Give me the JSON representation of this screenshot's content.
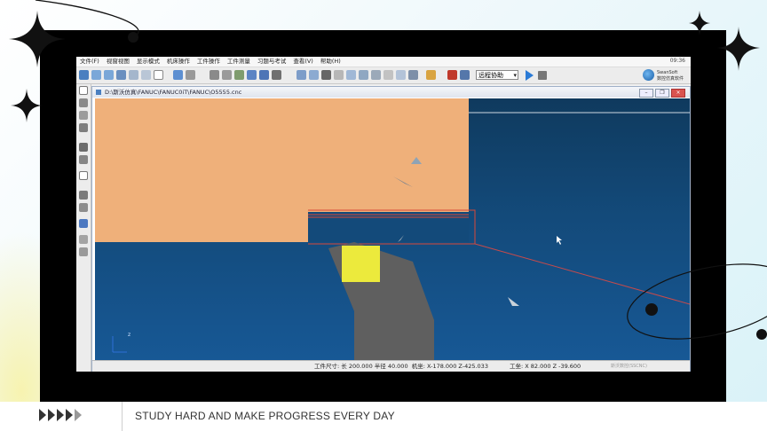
{
  "menu": [
    "文件(F)",
    "视窗视图",
    "显示模式",
    "机床操作",
    "工件操作",
    "工件测量",
    "习题与考试",
    "查看(V)",
    "帮助(H)"
  ],
  "clock": "09:36",
  "toolbar": {
    "mode_select": "远程协助"
  },
  "brand": {
    "name": "SwanSoft",
    "subtitle": "数控仿真软件"
  },
  "document": {
    "path": "D:\\斯沃仿真\\FANUC\\FANUC0iT\\FANUC\\O5555.cnc"
  },
  "status": {
    "workpiece_size": "工件尺寸: 长 200.000 半径 40.000",
    "machine_coords": "机坐: X-178.000  Z-425.033",
    "workpiece_coords": "工坐: X  82.000  Z -39.600",
    "watermark": "斯沃数控(SSCNC)"
  },
  "footer": {
    "slogan": "STUDY HARD AND MAKE PROGRESS EVERY DAY"
  },
  "colors": {
    "workpiece": "#efb07a",
    "scene_bg": "#134a7a",
    "tool_block": "#ecea3c",
    "tool_holder": "#5f5f5f",
    "toolpath": "#d84838"
  }
}
